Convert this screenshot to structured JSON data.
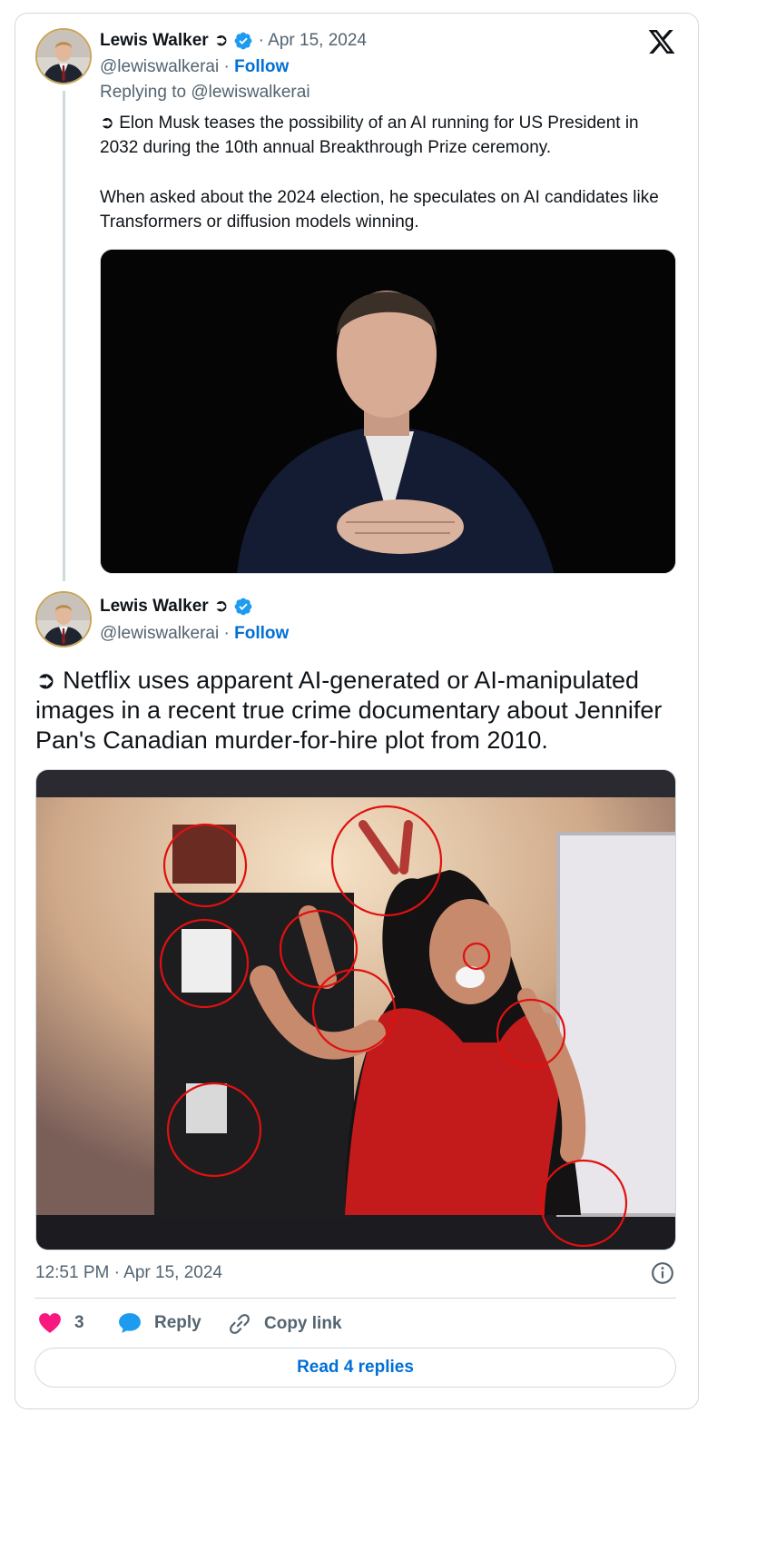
{
  "tweet1": {
    "author_name": "Lewis Walker",
    "name_symbol": "➲",
    "date": "· Apr 15, 2024",
    "handle": "@lewiswalkerai",
    "separator": "·",
    "follow_label": "Follow",
    "replying_to": "Replying to @lewiswalkerai",
    "text_line1": "➲ Elon Musk teases the possibility of an AI running for US President in 2032 during the 10th annual Breakthrough Prize ceremony.",
    "text_line2": "When asked about the 2024 election, he speculates on AI candidates like Transformers or diffusion models winning."
  },
  "tweet2": {
    "author_name": "Lewis Walker",
    "name_symbol": "➲",
    "handle": "@lewiswalkerai",
    "separator": "·",
    "follow_label": "Follow",
    "text": "➲ Netflix uses apparent AI-generated or AI-manipulated images in a recent true crime documentary about Jennifer Pan's Canadian murder-for-hire plot from 2010.",
    "timestamp": "12:51 PM · Apr 15, 2024"
  },
  "actions": {
    "like_count": "3",
    "reply_label": "Reply",
    "copy_link_label": "Copy link",
    "read_replies_label": "Read 4 replies"
  },
  "colors": {
    "accent_blue": "#006fd6",
    "verified_blue": "#1d9bf0",
    "like_pink": "#f91880",
    "annotation_red": "#e01010"
  },
  "icons": [
    "x-logo-icon",
    "verified-badge-icon",
    "heart-icon",
    "reply-bubble-icon",
    "link-icon",
    "info-icon"
  ]
}
